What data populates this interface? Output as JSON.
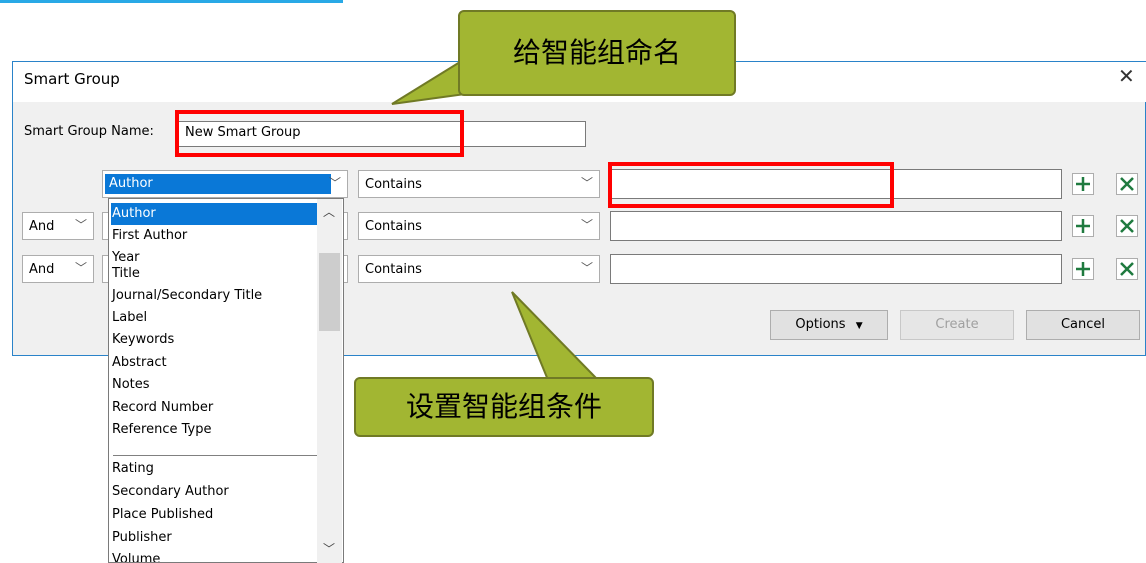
{
  "dialog": {
    "title": "Smart Group",
    "name_label": "Smart Group Name:",
    "name_value": "New Smart Group"
  },
  "rows": [
    {
      "connector": "",
      "field": "Author",
      "operator": "Contains",
      "value": ""
    },
    {
      "connector": "And",
      "field": "",
      "operator": "Contains",
      "value": ""
    },
    {
      "connector": "And",
      "field": "",
      "operator": "Contains",
      "value": ""
    }
  ],
  "field_dropdown": {
    "items": [
      "Author",
      "First Author",
      "Year",
      "Title",
      "Journal/Secondary Title",
      "Label",
      "Keywords",
      "Abstract",
      "Notes",
      "Record Number",
      "Reference Type"
    ],
    "items_after_separator": [
      "Rating",
      "Secondary Author",
      "Place Published",
      "Publisher",
      "Volume"
    ]
  },
  "buttons": {
    "options": "Options",
    "create": "Create",
    "cancel": "Cancel"
  },
  "annotations": {
    "callout_name": "给智能组命名",
    "callout_conditions": "设置智能组条件"
  },
  "colors": {
    "highlight_red": "#ff0000",
    "callout_fill": "#a2b632",
    "selection_blue": "#0a78d7"
  }
}
